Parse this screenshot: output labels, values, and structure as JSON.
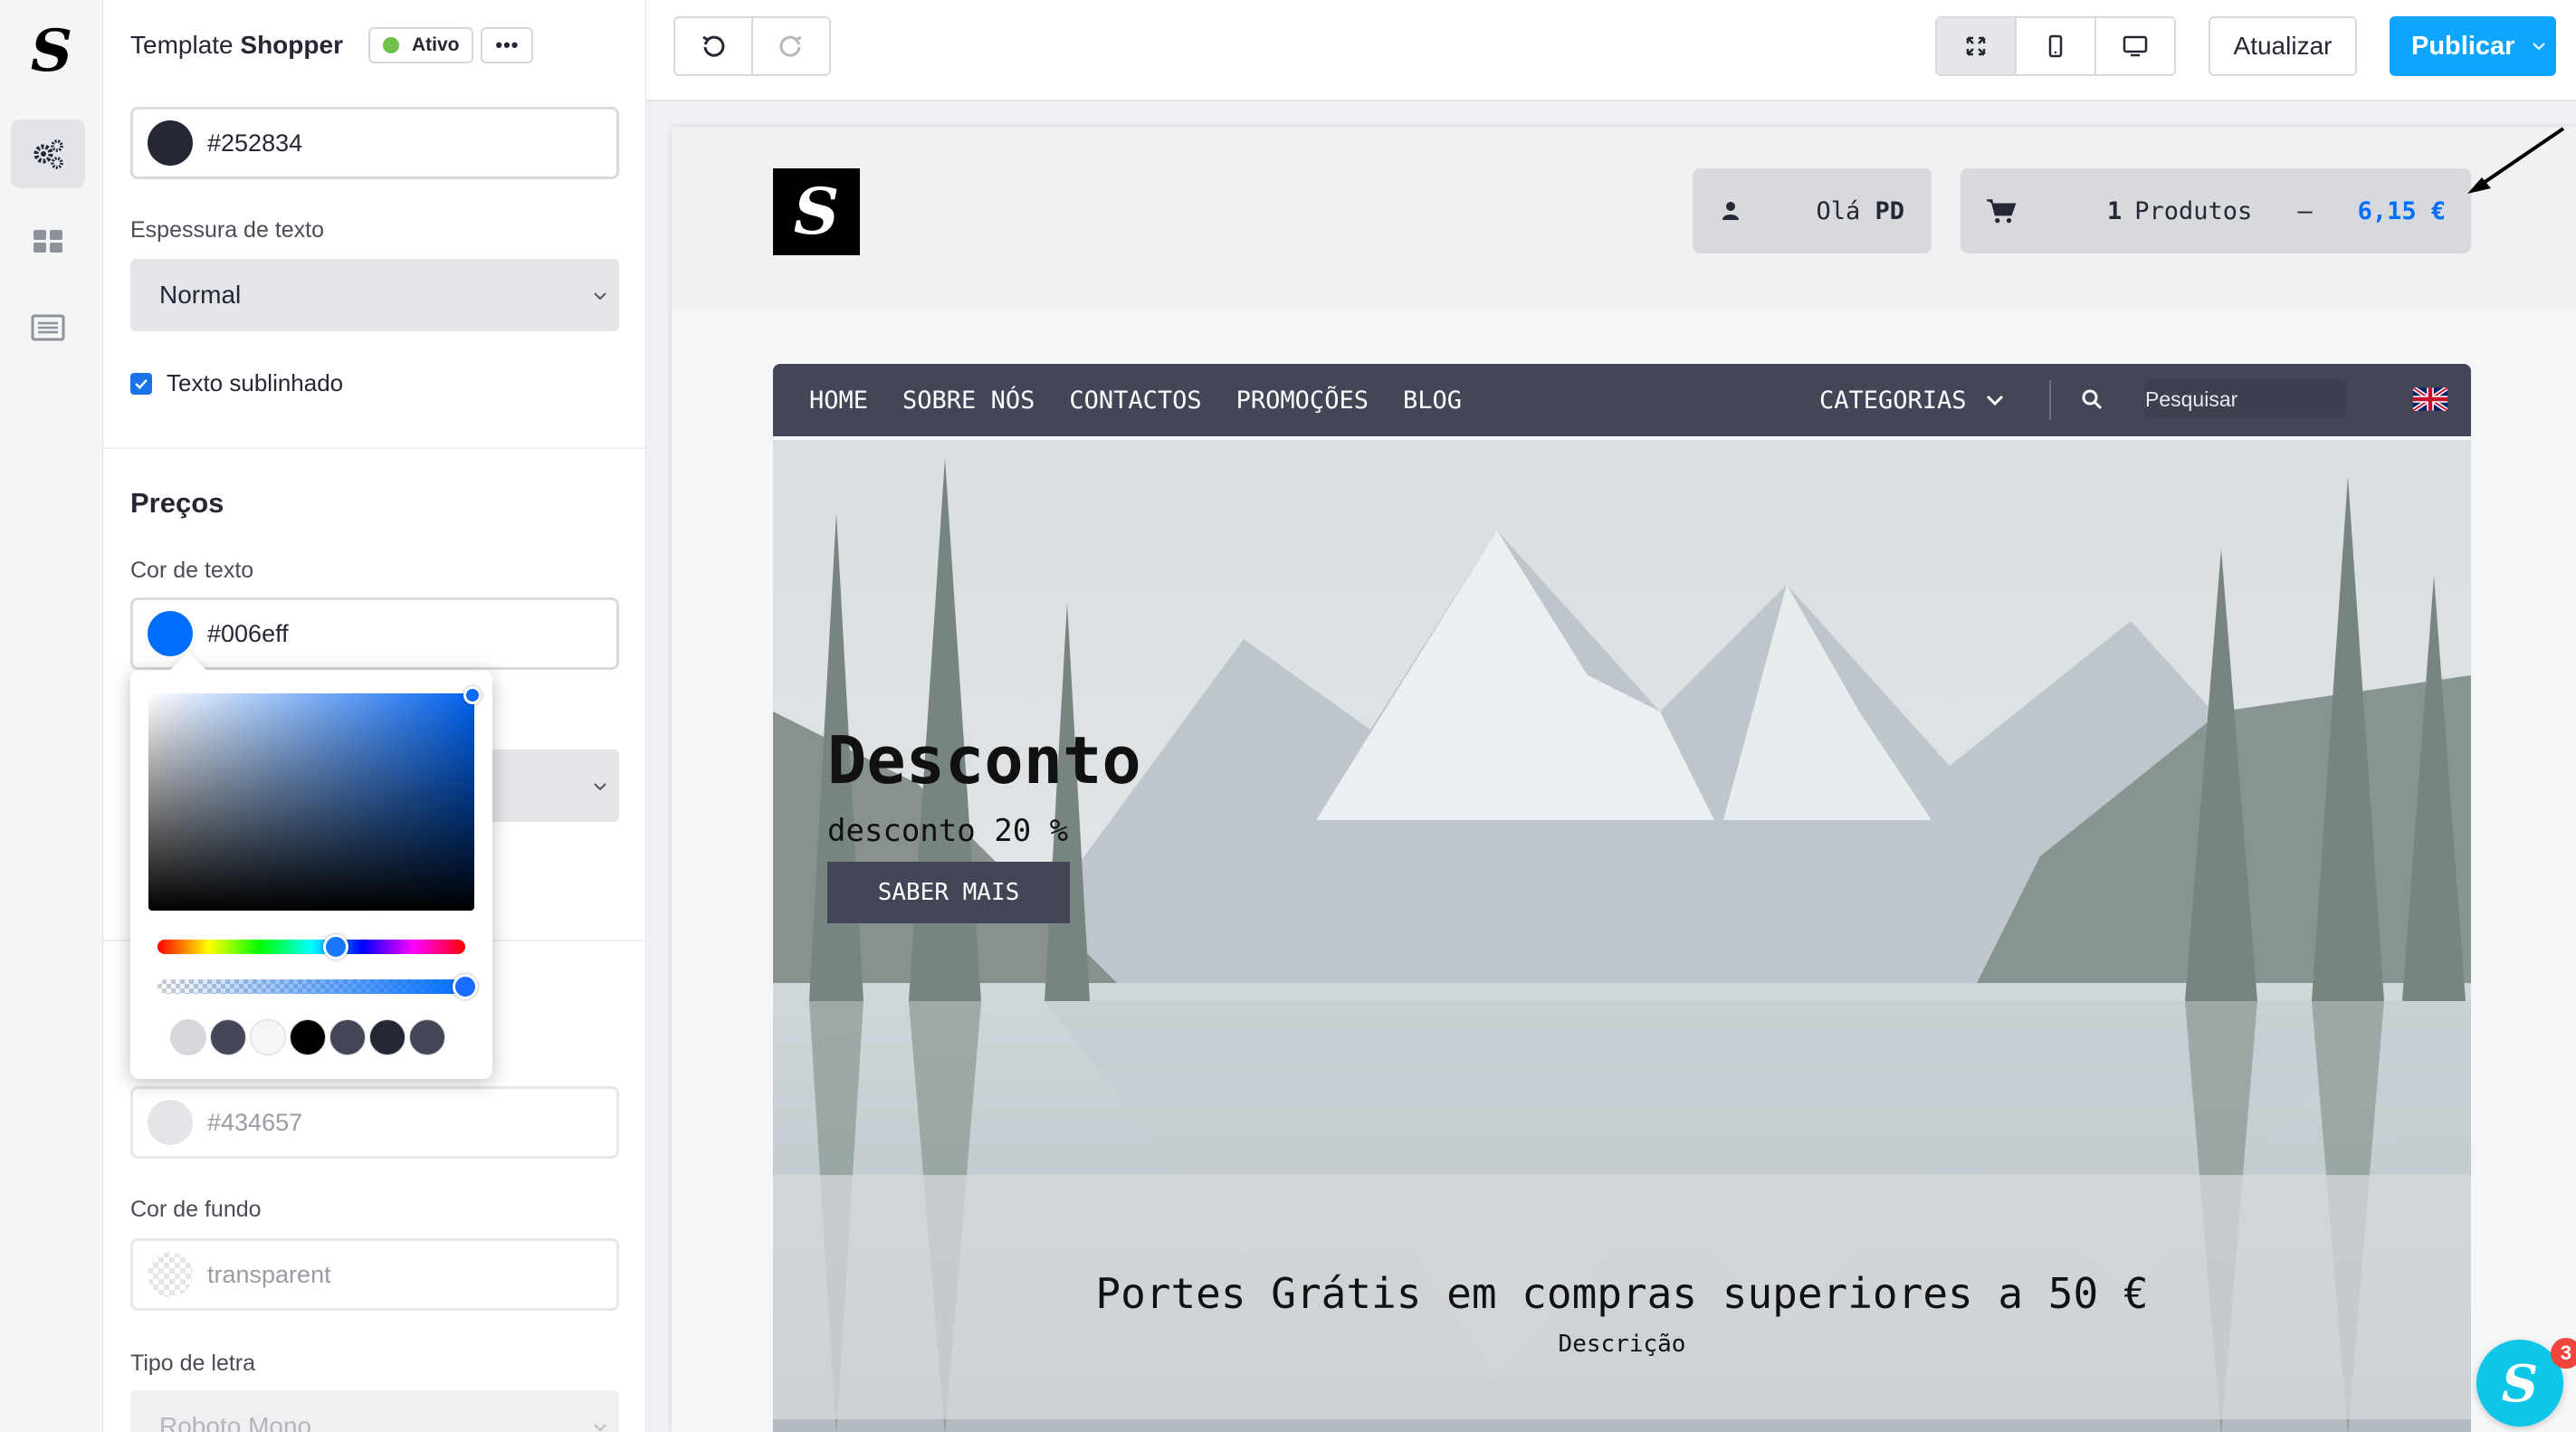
{
  "panel": {
    "template_name": "Template",
    "template_name_bold": "Shopper",
    "status": "Ativo",
    "more": "•••",
    "top_color": {
      "value": "#252834",
      "swatch": "#252834"
    },
    "text_weight_label": "Espessura de texto",
    "text_weight_value": "Normal",
    "underline_label": "Texto sublinhado",
    "underline_checked": true,
    "prices_title": "Preços",
    "price_color_label": "Cor de texto",
    "price_color": {
      "value": "#006eff",
      "swatch": "#006eff"
    },
    "second_color": {
      "value": "#434657",
      "swatch": "#e4e5e8"
    },
    "bg_color_label": "Cor de fundo",
    "bg_color_value": "transparent",
    "font_label": "Tipo de letra",
    "font_value": "Roboto Mono"
  },
  "picker": {
    "hue_percent": 58,
    "alpha_percent": 100,
    "presets": [
      "#d6d8dc",
      "#434657",
      "#f5f6f8",
      "#000000",
      "#434657",
      "#252834",
      "#434657"
    ]
  },
  "toolbar": {
    "update_label": "Atualizar",
    "publish_label": "Publicar"
  },
  "site": {
    "greeting": "Olá",
    "user": "PD",
    "cart_qty": "1",
    "cart_label": "Produtos",
    "cart_dash": "–",
    "cart_price": "6,15 €",
    "nav": [
      "HOME",
      "SOBRE NÓS",
      "CONTACTOS",
      "PROMOÇÕES",
      "BLOG"
    ],
    "categories": "CATEGORIAS",
    "search_placeholder": "Pesquisar",
    "hero_title": "Desconto",
    "hero_subtitle": "desconto 20 %",
    "hero_button": "SABER MAIS",
    "shipping_title": "Portes Grátis em compras superiores a 50 €",
    "shipping_desc": "Descrição"
  },
  "chat": {
    "count": "3"
  },
  "colors": {
    "accent": "#0ea5ff",
    "brand_dark": "#434657",
    "price_blue": "#006eff"
  }
}
